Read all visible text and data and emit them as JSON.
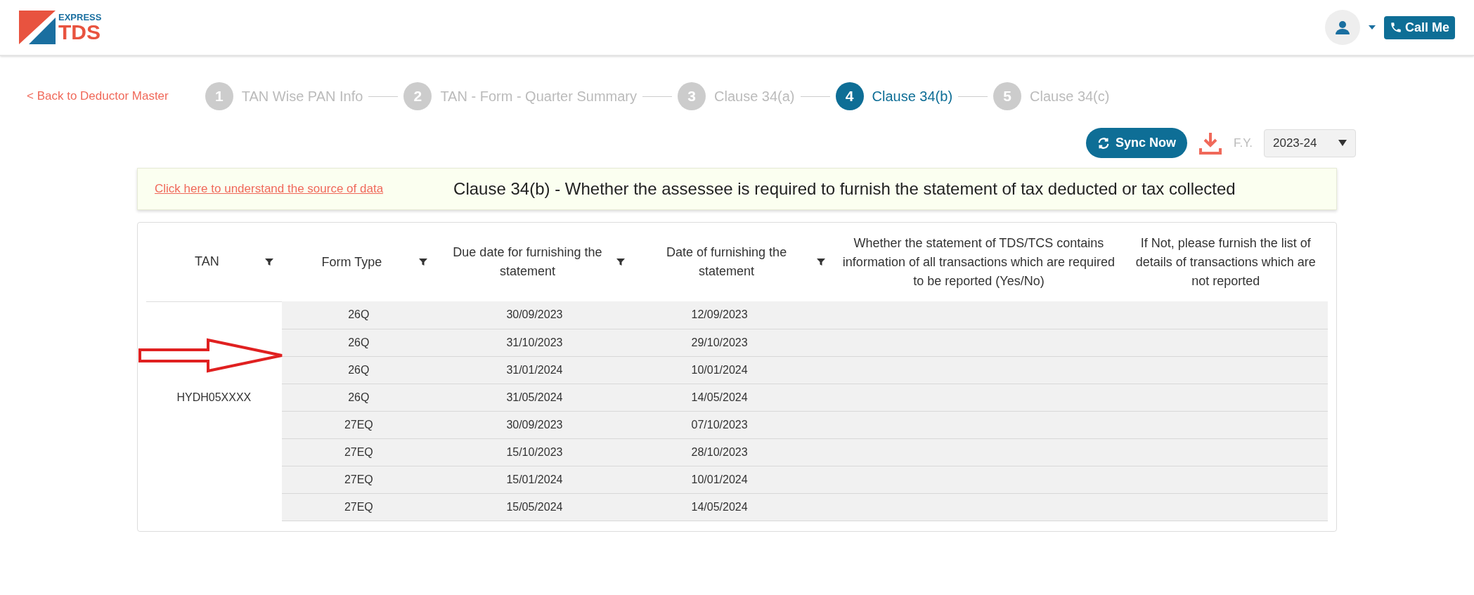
{
  "header": {
    "logo_top": "EXPRESS",
    "logo_bottom": "TDS",
    "call_button": "Call Me"
  },
  "back_link": "< Back to Deductor Master",
  "steps": [
    {
      "number": "1",
      "label": "TAN Wise PAN Info",
      "selected": false
    },
    {
      "number": "2",
      "label": "TAN - Form - Quarter Summary",
      "selected": false
    },
    {
      "number": "3",
      "label": "Clause 34(a)",
      "selected": false
    },
    {
      "number": "4",
      "label": "Clause 34(b)",
      "selected": true
    },
    {
      "number": "5",
      "label": "Clause 34(c)",
      "selected": false
    }
  ],
  "toolbar": {
    "sync_button": "Sync Now",
    "fy_label": "F.Y.",
    "fy_value": "2023-24"
  },
  "banner": {
    "link": "Click here to understand the source of data",
    "title": "Clause 34(b) - Whether the assessee is required to furnish the statement of tax deducted or tax collected"
  },
  "table": {
    "columns": [
      {
        "label": "TAN",
        "filterable": true
      },
      {
        "label": "Form Type",
        "filterable": true
      },
      {
        "label": "Due date for furnishing the statement",
        "filterable": true
      },
      {
        "label": "Date of furnishing the statement",
        "filterable": true
      },
      {
        "label": "Whether the statement of TDS/TCS contains information of all transactions which are required to be reported (Yes/No)",
        "filterable": false
      },
      {
        "label": "If Not, please furnish the list of details of transactions which are not reported",
        "filterable": false
      }
    ],
    "rows": [
      [
        "",
        "26Q",
        "30/09/2023",
        "12/09/2023"
      ],
      [
        "",
        "26Q",
        "31/10/2023",
        "29/10/2023"
      ],
      [
        "",
        "26Q",
        "31/01/2024",
        "10/01/2024"
      ],
      [
        "HYDH05XXXX",
        "26Q",
        "31/05/2024",
        "14/05/2024"
      ],
      [
        "",
        "27EQ",
        "30/09/2023",
        "07/10/2023"
      ],
      [
        "",
        "27EQ",
        "15/10/2023",
        "28/10/2023"
      ],
      [
        "",
        "27EQ",
        "15/01/2024",
        "10/01/2024"
      ],
      [
        "",
        "27EQ",
        "15/05/2024",
        "14/05/2024"
      ]
    ]
  }
}
